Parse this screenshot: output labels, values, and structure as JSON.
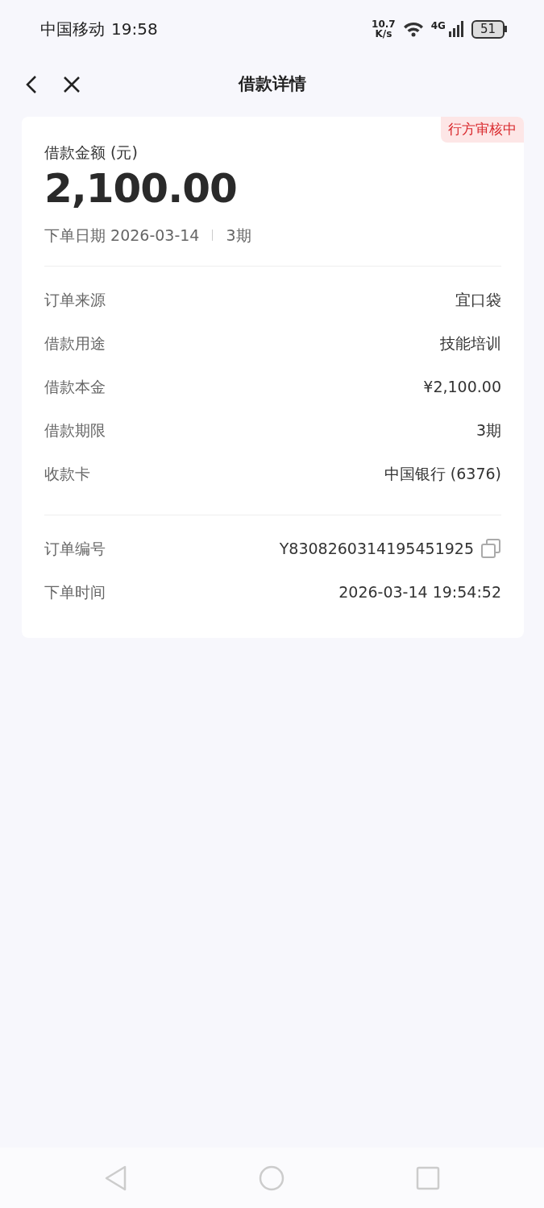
{
  "status_bar": {
    "carrier": "中国移动",
    "time": "19:58",
    "speed_value": "10.7",
    "speed_unit": "K/s",
    "network": "4G",
    "battery": "51"
  },
  "header": {
    "title": "借款详情"
  },
  "card": {
    "badge": "行方审核中",
    "amount_label": "借款金额 (元)",
    "amount": "2,100.00",
    "date_text": "下单日期 2026-03-14",
    "term": "3期",
    "groups": [
      [
        {
          "label": "订单来源",
          "value": "宜口袋",
          "copyable": false
        },
        {
          "label": "借款用途",
          "value": "技能培训",
          "copyable": false
        },
        {
          "label": "借款本金",
          "value": "¥2,100.00",
          "copyable": false
        },
        {
          "label": "借款期限",
          "value": "3期",
          "copyable": false
        },
        {
          "label": "收款卡",
          "value": "中国银行 (6376)",
          "copyable": false
        }
      ],
      [
        {
          "label": "订单编号",
          "value": "Y8308260314195451925",
          "copyable": true
        },
        {
          "label": "下单时间",
          "value": "2026-03-14 19:54:52",
          "copyable": false
        }
      ]
    ]
  }
}
